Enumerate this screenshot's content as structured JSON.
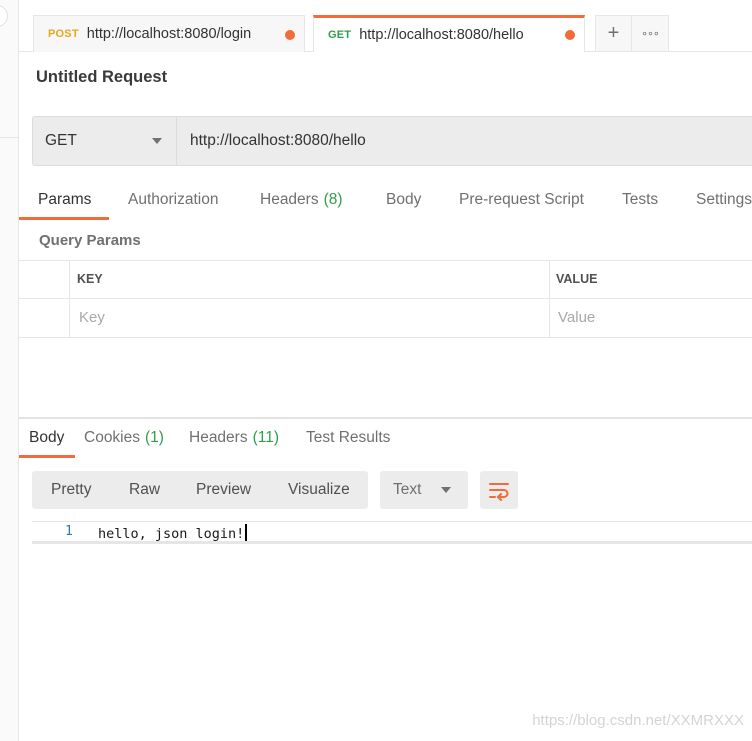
{
  "tabs": [
    {
      "method": "POST",
      "url": "http://localhost:8080/login",
      "unsaved": true,
      "active": false
    },
    {
      "method": "GET",
      "url": "http://localhost:8080/hello",
      "unsaved": true,
      "active": true
    }
  ],
  "tab_actions": {
    "new_tab_glyph": "+",
    "more_glyph": "∘∘∘"
  },
  "request": {
    "title": "Untitled Request",
    "method": "GET",
    "url": "http://localhost:8080/hello"
  },
  "request_tabs": [
    {
      "label": "Params",
      "count": ""
    },
    {
      "label": "Authorization",
      "count": ""
    },
    {
      "label": "Headers",
      "count": "(8)"
    },
    {
      "label": "Body",
      "count": ""
    },
    {
      "label": "Pre-request Script",
      "count": ""
    },
    {
      "label": "Tests",
      "count": ""
    },
    {
      "label": "Settings",
      "count": ""
    }
  ],
  "query_params": {
    "label": "Query Params",
    "columns": [
      "KEY",
      "VALUE"
    ],
    "key_placeholder": "Key",
    "value_placeholder": "Value"
  },
  "response_tabs": [
    {
      "label": "Body",
      "count": ""
    },
    {
      "label": "Cookies",
      "count": "(1)"
    },
    {
      "label": "Headers",
      "count": "(11)"
    },
    {
      "label": "Test Results",
      "count": ""
    }
  ],
  "view_modes": [
    "Pretty",
    "Raw",
    "Preview",
    "Visualize"
  ],
  "format": "Text",
  "response_body": {
    "line_number": "1",
    "text": "hello, json login!"
  },
  "watermark": "https://blog.csdn.net/XXMRXXX",
  "colors": {
    "accent": "#f26b3a",
    "post_method": "#e9a51c",
    "get_method": "#2f9e4a",
    "count": "#2f9e4a"
  },
  "icons": {
    "caret": "chevron-down-icon",
    "wrap": "wrap-lines-icon",
    "unsaved": "unsaved-dot-icon"
  }
}
